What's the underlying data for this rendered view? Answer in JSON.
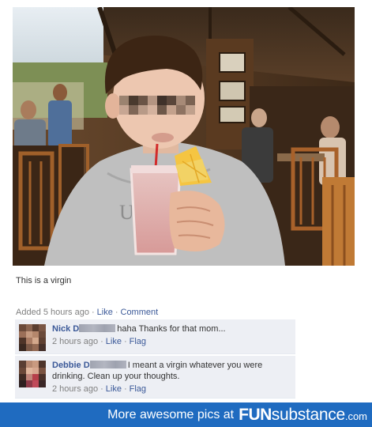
{
  "photo": {
    "description_icon": "photo-image",
    "shirt_text": "U S"
  },
  "post": {
    "caption": "This is a virgin",
    "added": "Added 5 hours ago",
    "like_label": "Like",
    "comment_label": "Comment"
  },
  "comments": [
    {
      "author": "Nick D",
      "text": "haha Thanks for that mom...",
      "time": "2 hours ago",
      "like_label": "Like",
      "flag_label": "Flag"
    },
    {
      "author": "Debbie D",
      "text": "I meant a virgin whatever you were drinking. Clean up your thoughts.",
      "time": "2 hours ago",
      "like_label": "Like",
      "flag_label": "Flag"
    }
  ],
  "footer": {
    "tagline": "More awesome pics at",
    "logo_bold": "FUN",
    "logo_light": "substance",
    "logo_dotcom": ".com"
  },
  "colors": {
    "link": "#3b5998",
    "comment_bg": "#edeff4",
    "footer_bg": "#1f6bc0",
    "meta_gray": "#808080"
  }
}
